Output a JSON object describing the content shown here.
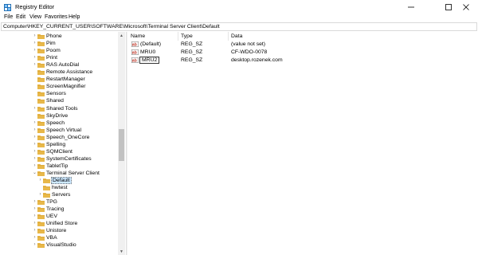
{
  "window": {
    "title": "Registry Editor",
    "minimize_glyph": "—",
    "maximize_glyph": "☐",
    "close_glyph": "✕"
  },
  "menu": {
    "file": "File",
    "edit": "Edit",
    "view": "View",
    "favorites": "Favorites",
    "help": "Help"
  },
  "address": {
    "path": "Computer\\HKEY_CURRENT_USER\\SOFTWARE\\Microsoft\\Terminal Server Client\\Default"
  },
  "tree": {
    "items": [
      {
        "label": "Phone",
        "expander": "›",
        "level": 0
      },
      {
        "label": "Pim",
        "expander": "›",
        "level": 0
      },
      {
        "label": "Poom",
        "expander": "›",
        "level": 0
      },
      {
        "label": "Print",
        "expander": "›",
        "level": 0
      },
      {
        "label": "RAS AutoDial",
        "expander": "›",
        "level": 0
      },
      {
        "label": "Remote Assistance",
        "expander": "",
        "level": 0
      },
      {
        "label": "RestartManager",
        "expander": "",
        "level": 0
      },
      {
        "label": "ScreenMagnifier",
        "expander": "",
        "level": 0
      },
      {
        "label": "Sensors",
        "expander": "",
        "level": 0
      },
      {
        "label": "Shared",
        "expander": "",
        "level": 0
      },
      {
        "label": "Shared Tools",
        "expander": "›",
        "level": 0
      },
      {
        "label": "SkyDrive",
        "expander": "",
        "level": 0
      },
      {
        "label": "Speech",
        "expander": "›",
        "level": 0
      },
      {
        "label": "Speech Virtual",
        "expander": "›",
        "level": 0
      },
      {
        "label": "Speech_OneCore",
        "expander": "›",
        "level": 0
      },
      {
        "label": "Spelling",
        "expander": "›",
        "level": 0
      },
      {
        "label": "SQMClient",
        "expander": "›",
        "level": 0
      },
      {
        "label": "SystemCertificates",
        "expander": "›",
        "level": 0
      },
      {
        "label": "TabletTip",
        "expander": "›",
        "level": 0
      },
      {
        "label": "Terminal Server Client",
        "expander": "⌄",
        "level": 0
      },
      {
        "label": "Default",
        "expander": "›",
        "level": 1,
        "selected": true
      },
      {
        "label": "hwtest",
        "expander": "",
        "level": 1
      },
      {
        "label": "Servers",
        "expander": "›",
        "level": 1
      },
      {
        "label": "TPG",
        "expander": "›",
        "level": 0
      },
      {
        "label": "Tracing",
        "expander": "›",
        "level": 0
      },
      {
        "label": "UEV",
        "expander": "›",
        "level": 0
      },
      {
        "label": "Unified Store",
        "expander": "›",
        "level": 0
      },
      {
        "label": "Unistore",
        "expander": "›",
        "level": 0
      },
      {
        "label": "VBA",
        "expander": "›",
        "level": 0
      },
      {
        "label": "VisualStudio",
        "expander": "›",
        "level": 0
      }
    ]
  },
  "list": {
    "headers": {
      "name": "Name",
      "type": "Type",
      "data": "Data"
    },
    "rows": [
      {
        "name": "(Default)",
        "type": "REG_SZ",
        "data": "(value not set)",
        "icon": "string-value-icon"
      },
      {
        "name": "MRU0",
        "type": "REG_SZ",
        "data": "CF-WDO-0078",
        "icon": "string-value-icon"
      },
      {
        "name": "MRU2",
        "type": "REG_SZ",
        "data": "desktop.rozenek.com",
        "icon": "string-value-icon",
        "editing": true
      }
    ]
  },
  "colors": {
    "folder": "#e8b84a",
    "folder_dark": "#d9a330",
    "selection": "#cce8ff",
    "value_icon_red": "#c0392b"
  }
}
